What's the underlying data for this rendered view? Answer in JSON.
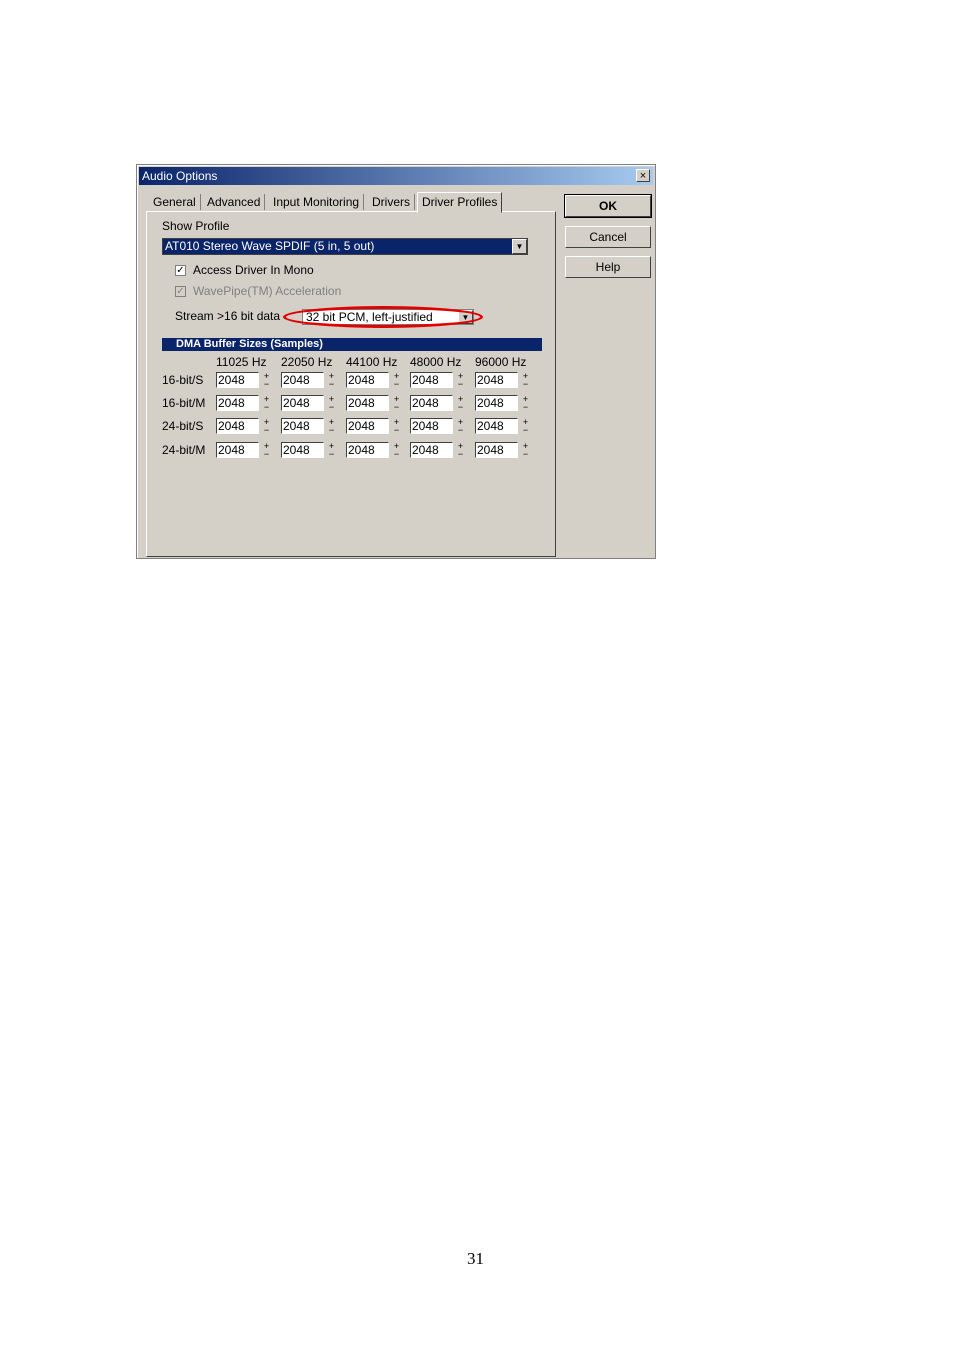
{
  "window": {
    "title": "Audio Options",
    "close_label": "×"
  },
  "tabs": [
    {
      "label": "General",
      "active": false
    },
    {
      "label": "Advanced",
      "active": false
    },
    {
      "label": "Input Monitoring",
      "active": false
    },
    {
      "label": "Drivers",
      "active": false
    },
    {
      "label": "Driver Profiles",
      "active": true
    }
  ],
  "profile": {
    "show_profile_label": "Show Profile",
    "selected": "AT010 Stereo Wave SPDIF (5 in, 5 out)"
  },
  "options": {
    "access_mono": {
      "label": "Access Driver In Mono",
      "checked": true,
      "enabled": true
    },
    "wavepipe": {
      "label": "WavePipe(TM) Acceleration",
      "checked": true,
      "enabled": false
    },
    "stream_label": "Stream >16 bit data",
    "stream_value": "32 bit PCM, left-justified"
  },
  "dma": {
    "title": "DMA Buffer Sizes (Samples)",
    "columns": [
      "11025 Hz",
      "22050 Hz",
      "44100 Hz",
      "48000 Hz",
      "96000 Hz"
    ],
    "rows": [
      {
        "label": "16-bit/S",
        "values": [
          "2048",
          "2048",
          "2048",
          "2048",
          "2048"
        ]
      },
      {
        "label": "16-bit/M",
        "values": [
          "2048",
          "2048",
          "2048",
          "2048",
          "2048"
        ]
      },
      {
        "label": "24-bit/S",
        "values": [
          "2048",
          "2048",
          "2048",
          "2048",
          "2048"
        ]
      },
      {
        "label": "24-bit/M",
        "values": [
          "2048",
          "2048",
          "2048",
          "2048",
          "2048"
        ]
      }
    ]
  },
  "buttons": {
    "ok": "OK",
    "cancel": "Cancel",
    "help": "Help"
  },
  "annotation": {
    "highlight_color": "#e00000"
  },
  "page_number": "31"
}
